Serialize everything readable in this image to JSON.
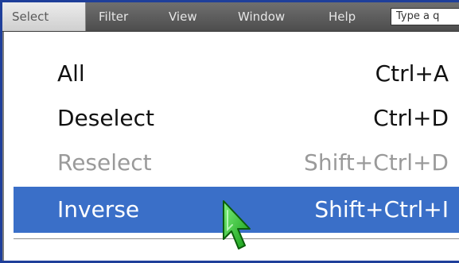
{
  "menubar": {
    "items": [
      {
        "label": "Select",
        "active": true
      },
      {
        "label": "Filter"
      },
      {
        "label": "View"
      },
      {
        "label": "Window"
      },
      {
        "label": "Help"
      }
    ],
    "search_text": "Type a q"
  },
  "dropdown": {
    "items": [
      {
        "label": "All",
        "shortcut": "Ctrl+A",
        "state": "normal"
      },
      {
        "label": "Deselect",
        "shortcut": "Ctrl+D",
        "state": "normal"
      },
      {
        "label": "Reselect",
        "shortcut": "Shift+Ctrl+D",
        "state": "disabled"
      },
      {
        "label": "Inverse",
        "shortcut": "Shift+Ctrl+I",
        "state": "highlighted"
      }
    ]
  },
  "colors": {
    "menubar_bg": "#5c5c5c",
    "highlight": "#3a6fc8",
    "frame_border": "#1f3f9a",
    "cursor_fill": "#2ecc2e"
  },
  "icons": {
    "cursor": "arrow-pointer-icon"
  }
}
